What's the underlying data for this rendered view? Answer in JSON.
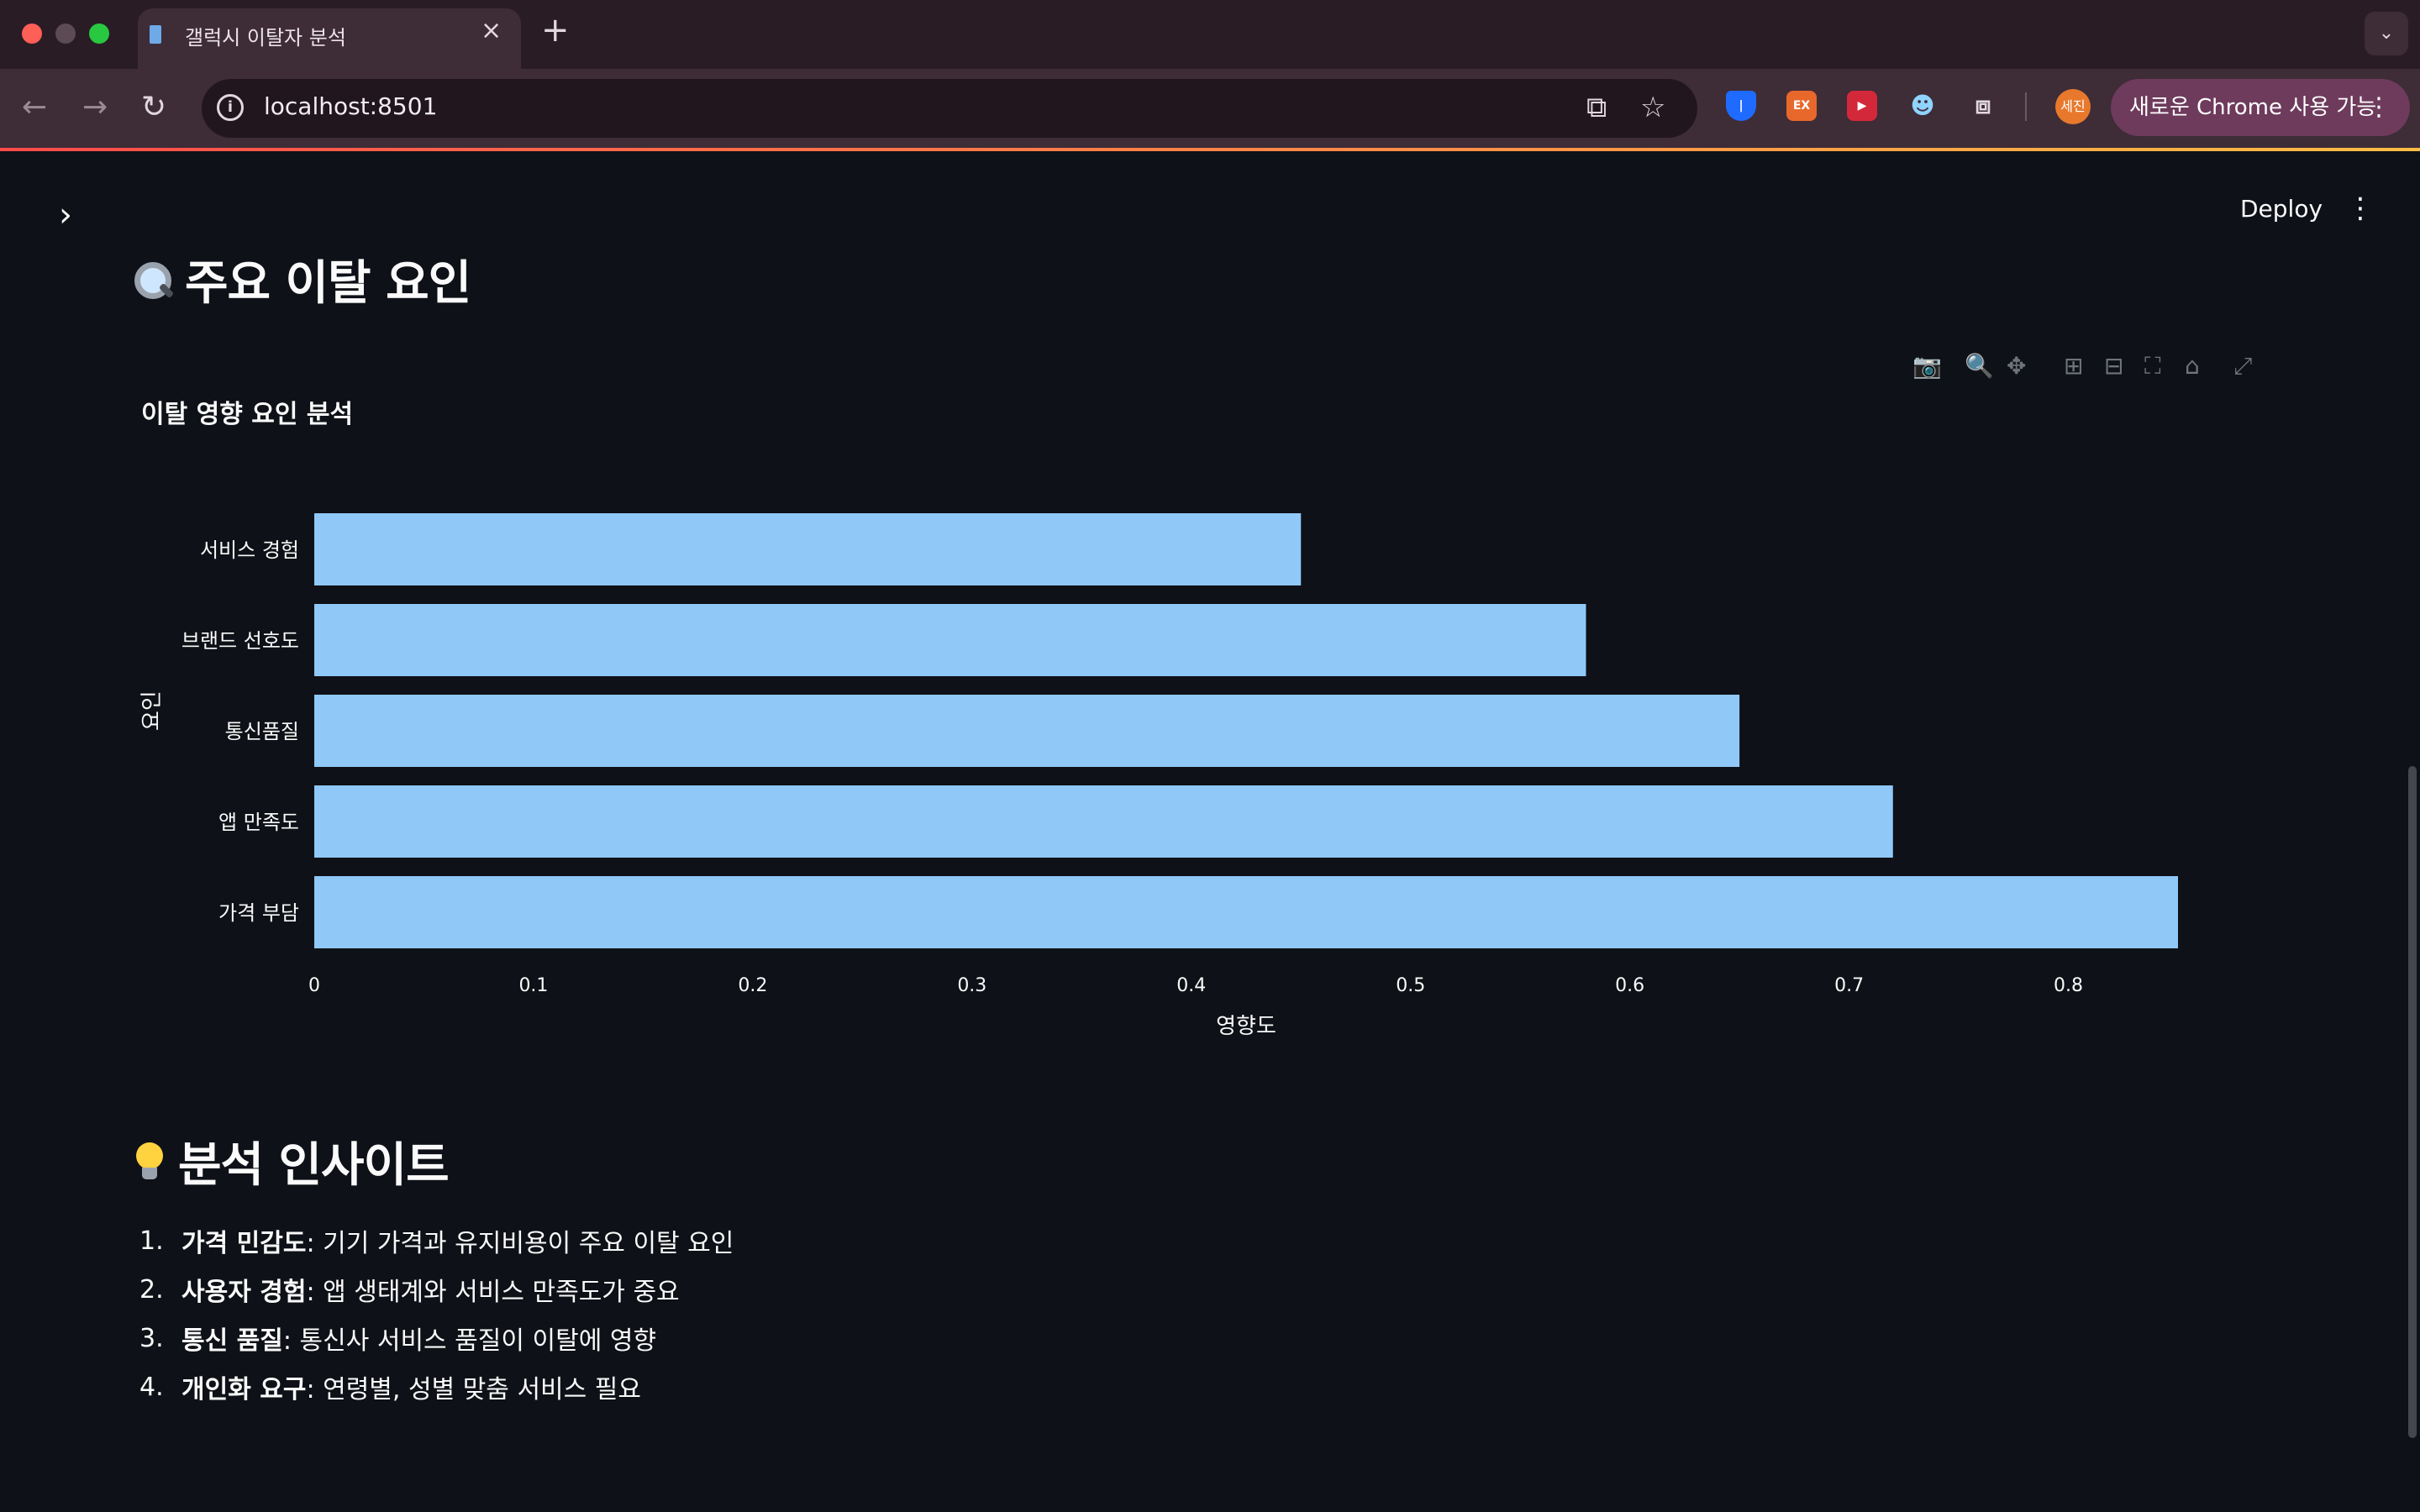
{
  "browser": {
    "tab_title": "갤럭시 이탈자 분석",
    "url": "localhost:8501",
    "profile_initials": "세진",
    "update_label": "새로운 Chrome 사용 가능",
    "extensions": [
      "bitwarden-icon",
      "ex-extension-icon",
      "video-extension-icon",
      "cat-extension-icon",
      "puzzle-icon"
    ]
  },
  "app": {
    "deploy_label": "Deploy",
    "header1": "주요 이탈 요인",
    "header2": "분석 인사이트",
    "insights": [
      {
        "num": "1.",
        "title": "가격 민감도",
        "text": ": 기기 가격과 유지비용이 주요 이탈 요인"
      },
      {
        "num": "2.",
        "title": "사용자 경험",
        "text": ": 앱 생태계와 서비스 만족도가 중요"
      },
      {
        "num": "3.",
        "title": "통신 품질",
        "text": ": 통신사 서비스 품질이 이탈에 영향"
      },
      {
        "num": "4.",
        "title": "개인화 요구",
        "text": ": 연령별, 성별 맞춤 서비스 필요"
      }
    ]
  },
  "chart_data": {
    "type": "bar",
    "orientation": "horizontal",
    "title": "이탈 영향 요인 분석",
    "xlabel": "영향도",
    "ylabel": "요인",
    "categories": [
      "서비스 경험",
      "브랜드 선호도",
      "통신품질",
      "앱 만족도",
      "가격 부담"
    ],
    "values": [
      0.45,
      0.58,
      0.65,
      0.72,
      0.85
    ],
    "xlim": [
      0,
      0.85
    ],
    "xticks": [
      "0",
      "0.1",
      "0.2",
      "0.3",
      "0.4",
      "0.5",
      "0.6",
      "0.7",
      "0.8"
    ],
    "bar_color": "#90c8f8",
    "grid": false
  }
}
